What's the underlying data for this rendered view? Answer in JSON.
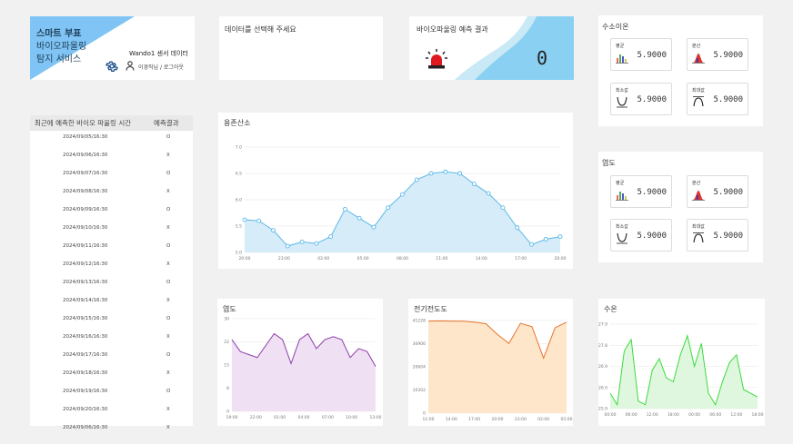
{
  "brand": {
    "line1": "스마트 부표",
    "line2": "바이오파울링",
    "line3": "탐지 서비스",
    "sensor": "Wando1 센서 데이터",
    "user": "이경직님 / 로그아웃"
  },
  "select_card": {
    "title": "데이터를 선택해 주세요"
  },
  "predict_card": {
    "title": "바이오파울링 예측 결과",
    "value": "0"
  },
  "ion_card": {
    "title": "수소이온",
    "boxes": [
      {
        "label": "평균",
        "value": "5.9000",
        "icon": "bar-chart-icon"
      },
      {
        "label": "분산",
        "value": "5.9000",
        "icon": "distribution-icon"
      },
      {
        "label": "최소값",
        "value": "5.9000",
        "icon": "min-curve-icon"
      },
      {
        "label": "최대값",
        "value": "5.9000",
        "icon": "max-curve-icon"
      }
    ]
  },
  "sal_card": {
    "title": "염도",
    "boxes": [
      {
        "label": "평균",
        "value": "5.9000",
        "icon": "bar-chart-icon"
      },
      {
        "label": "분산",
        "value": "5.9000",
        "icon": "distribution-icon"
      },
      {
        "label": "최소값",
        "value": "5.9000",
        "icon": "min-curve-icon"
      },
      {
        "label": "최대값",
        "value": "5.9000",
        "icon": "max-curve-icon"
      }
    ]
  },
  "table": {
    "header_time": "최근에 예측한 바이오 파울링 시간",
    "header_result": "예측결과",
    "rows": [
      {
        "date": "2024/09/05/16:30",
        "result": "O"
      },
      {
        "date": "2024/09/06/16:30",
        "result": "X"
      },
      {
        "date": "2024/09/07/16:30",
        "result": "O"
      },
      {
        "date": "2024/09/08/16:30",
        "result": "X"
      },
      {
        "date": "2024/09/09/16:30",
        "result": "O"
      },
      {
        "date": "2024/09/10/16:30",
        "result": "X"
      },
      {
        "date": "2024/09/11/16:30",
        "result": "O"
      },
      {
        "date": "2024/09/12/16:30",
        "result": "X"
      },
      {
        "date": "2024/09/13/16:30",
        "result": "O"
      },
      {
        "date": "2024/09/14/16:30",
        "result": "X"
      },
      {
        "date": "2024/09/15/16:30",
        "result": "O"
      },
      {
        "date": "2024/09/16/16:30",
        "result": "X"
      },
      {
        "date": "2024/09/17/16:30",
        "result": "O"
      },
      {
        "date": "2024/09/18/16:30",
        "result": "X"
      },
      {
        "date": "2024/09/19/16:30",
        "result": "O"
      },
      {
        "date": "2024/09/20/16:30",
        "result": "X"
      },
      {
        "date": "2024/09/06/16:30",
        "result": "X"
      }
    ]
  },
  "chart_data": [
    {
      "type": "area",
      "title": "용존산소",
      "color": "#5bb8e8",
      "fill": "#d6ecf8",
      "x_labels": [
        "20:00",
        "23:00",
        "02:00",
        "05:00",
        "08:00",
        "11:00",
        "14:00",
        "17:00",
        "20:00"
      ],
      "y_ticks": [
        "7.0",
        "6.5",
        "6.0",
        "5.5",
        "5.0"
      ],
      "ylim": [
        5.0,
        7.0
      ],
      "markers": true,
      "values": [
        5.62,
        5.6,
        5.42,
        5.12,
        5.2,
        5.17,
        5.3,
        5.82,
        5.65,
        5.48,
        5.85,
        6.1,
        6.38,
        6.5,
        6.53,
        6.5,
        6.3,
        6.12,
        5.85,
        5.47,
        5.15,
        5.25,
        5.3
      ]
    },
    {
      "type": "area",
      "title": "염도",
      "color": "#8e3fa8",
      "fill": "#efe0f4",
      "x_labels": [
        "19:00",
        "22:00",
        "01:00",
        "04:00",
        "07:00",
        "10:00",
        "13:00"
      ],
      "y_ticks": [
        "30",
        "22",
        "15",
        "8",
        "0"
      ],
      "ylim": [
        0,
        31
      ],
      "markers": false,
      "values": [
        24,
        20,
        19,
        18,
        22,
        26,
        24,
        16,
        24,
        26,
        21,
        24,
        25,
        24,
        18,
        21,
        20,
        15
      ]
    },
    {
      "type": "area",
      "title": "전기전도도",
      "color": "#e8732a",
      "fill": "#fde6c9",
      "x_labels": [
        "11:00",
        "14:00",
        "17:00",
        "20:00",
        "23:00",
        "02:00",
        "05:00"
      ],
      "y_ticks": [
        "41228",
        "30906",
        "20604",
        "10302",
        "0"
      ],
      "ylim": [
        0,
        41228
      ],
      "markers": false,
      "values": [
        41000,
        41100,
        41000,
        40900,
        40500,
        39800,
        35000,
        31000,
        40000,
        38500,
        24500,
        38000,
        40500
      ]
    },
    {
      "type": "area",
      "title": "수온",
      "color": "#3ddc3d",
      "fill": "#dff6df",
      "x_labels": [
        "00:00",
        "06:00",
        "12:00",
        "18:00",
        "00:00",
        "06:00",
        "12:00",
        "18:00"
      ],
      "y_ticks": [
        "27.9",
        "27.8",
        "26.9",
        "26.0",
        "25.9"
      ],
      "ylim": [
        25.8,
        28.0
      ],
      "markers": false,
      "values": [
        26.2,
        25.9,
        27.3,
        27.6,
        26.0,
        25.9,
        26.8,
        27.1,
        26.6,
        26.5,
        27.2,
        27.7,
        26.9,
        27.5,
        26.2,
        25.9,
        26.5,
        27.0,
        27.2,
        26.3,
        26.2,
        26.1
      ]
    }
  ]
}
